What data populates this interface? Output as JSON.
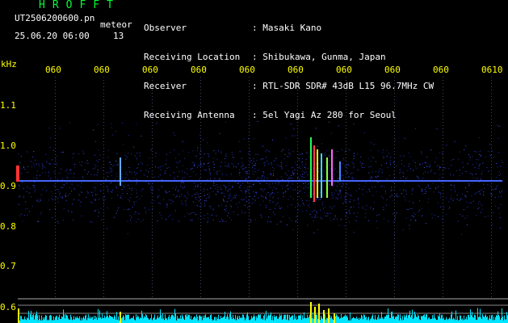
{
  "header": {
    "title": "HROFFT",
    "file_name": "UT2506200600.pn",
    "meteor_label": "meteor",
    "date_time": "25.06.20 06:00",
    "meteor_count": "13",
    "labels": [
      "Observer",
      "Receiving Location",
      "Receiver",
      "Receiving Antenna"
    ],
    "values": [
      ": Masaki Kano",
      ": Shibukawa, Gunma, Japan",
      ": RTL-SDR SDR# 43dB L15 96.7MHz CW",
      ": 5el Yagi Az 280 for Seoul"
    ]
  },
  "axis": {
    "unit": "kHz",
    "x_ticks": [
      "060",
      "060",
      "060",
      "060",
      "060",
      "060",
      "060",
      "060",
      "060",
      "0610"
    ],
    "y_ticks": [
      "1.1",
      "1.0",
      "0.9",
      "0.8",
      "0.7",
      "0.6"
    ]
  },
  "colors": {
    "background": "#000000",
    "text_white": "#ffffff",
    "text_yellow": "#ffff00",
    "title_green": "#00ff33",
    "echo_line": "#3355ff",
    "level_cyan": "#00e5ff"
  }
}
